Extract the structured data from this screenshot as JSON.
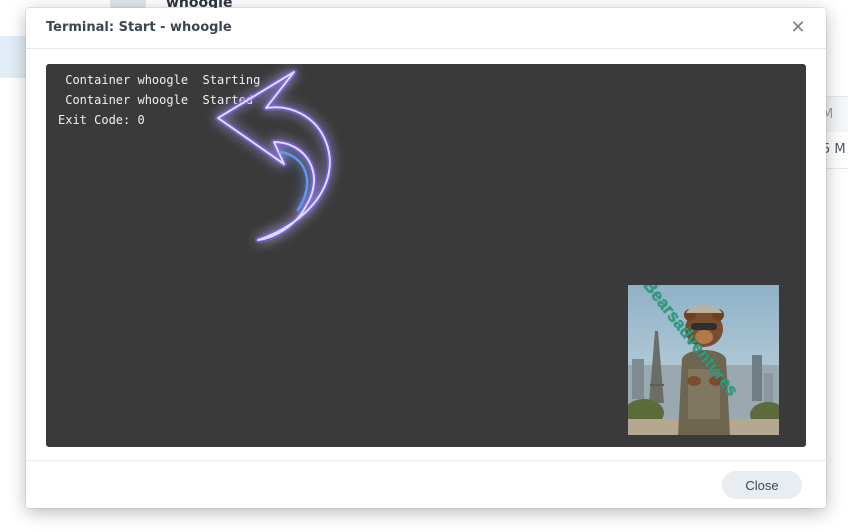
{
  "background": {
    "app_title": "whoogle",
    "col_values": [
      "M",
      "5 M"
    ]
  },
  "dialog": {
    "title": "Terminal: Start - whoogle",
    "close_icon_glyph": "✕",
    "terminal_lines": [
      " Container whoogle  Starting",
      " Container whoogle  Started",
      "Exit Code: 0"
    ],
    "image_watermark": "Bearsadventures",
    "close_button_label": "Close"
  },
  "colors": {
    "terminal_bg": "#3a3a3a",
    "terminal_text": "#f0f0f0",
    "arrow_glow": "#6b4dff",
    "watermark": "#2a9d7c"
  },
  "icons": [
    "close-icon",
    "back-arrow-graphic"
  ]
}
